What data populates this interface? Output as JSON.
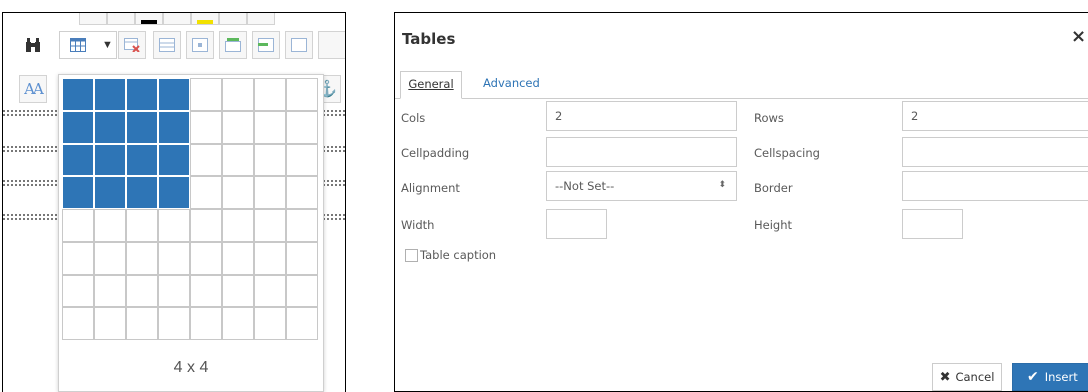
{
  "table_picker": {
    "rows": 8,
    "cols": 8,
    "selected_rows": 4,
    "selected_cols": 4,
    "size_label": "4 x 4",
    "accent_color": "#2e75b6"
  },
  "toolbar": {
    "icons": [
      "binoculars-icon",
      "table-icon",
      "dropdown-arrow-icon",
      "delete-table-icon",
      "table-props-icon",
      "cell-props-icon",
      "insert-row-icon",
      "delete-row-icon",
      "font-size-icon",
      "anchor-icon"
    ]
  },
  "dialog": {
    "title": "Tables",
    "close_label": "×",
    "tabs": [
      {
        "label": "General",
        "active": true
      },
      {
        "label": "Advanced",
        "active": false
      }
    ],
    "fields": {
      "cols": {
        "label": "Cols",
        "value": "2"
      },
      "rows": {
        "label": "Rows",
        "value": "2"
      },
      "cellpadding": {
        "label": "Cellpadding",
        "value": ""
      },
      "cellspacing": {
        "label": "Cellspacing",
        "value": ""
      },
      "alignment": {
        "label": "Alignment",
        "value": "--Not Set--"
      },
      "border": {
        "label": "Border",
        "value": ""
      },
      "width": {
        "label": "Width",
        "value": ""
      },
      "height": {
        "label": "Height",
        "value": ""
      }
    },
    "caption": {
      "label": "Table caption",
      "checked": false
    },
    "buttons": {
      "cancel": "Cancel",
      "insert": "Insert"
    }
  }
}
